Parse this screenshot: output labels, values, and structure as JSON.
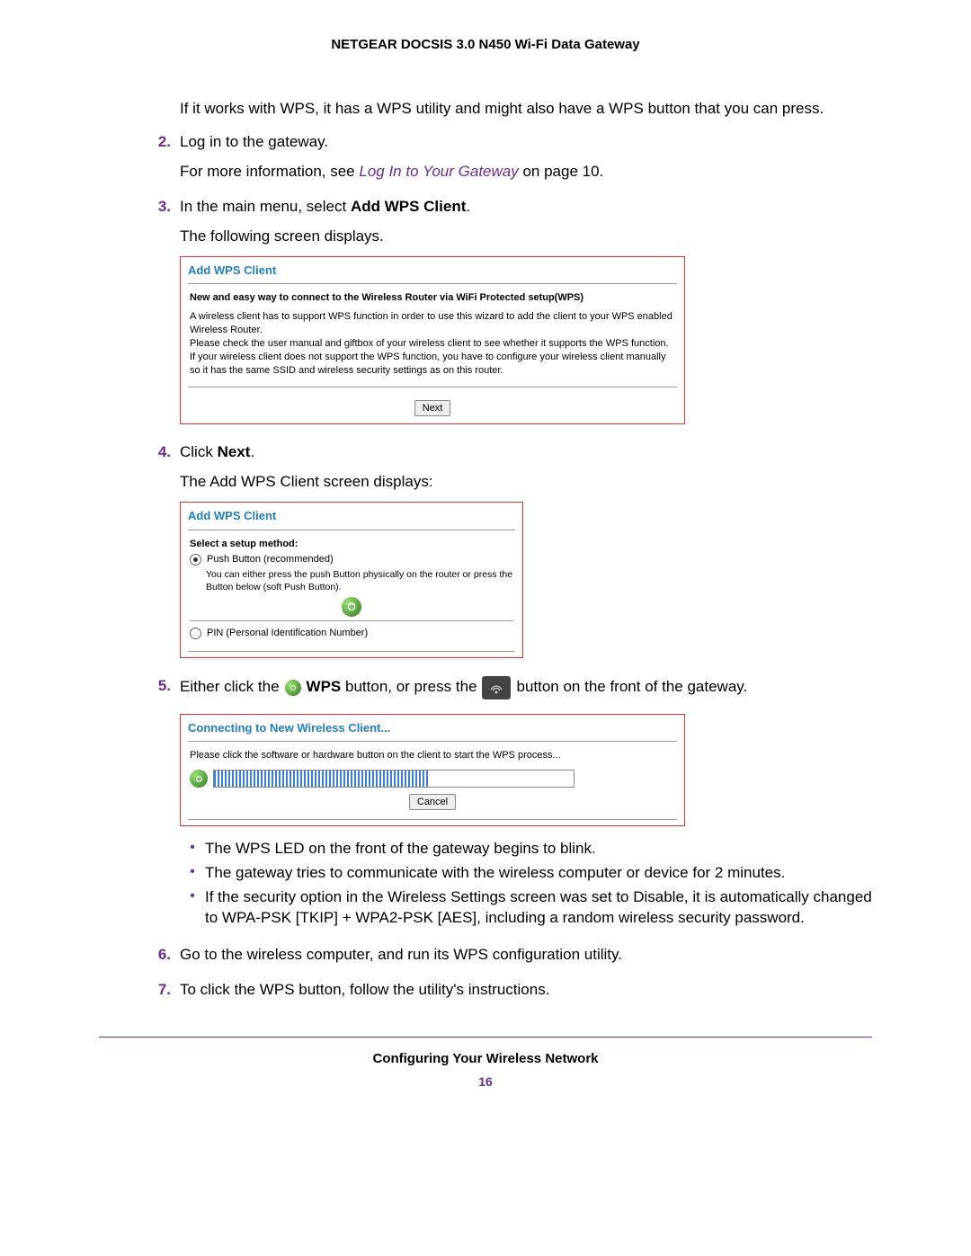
{
  "header": "NETGEAR DOCSIS 3.0 N450 Wi-Fi Data Gateway",
  "intro": "If it works with WPS, it has a WPS utility and might also have a WPS button that you can press.",
  "step2": {
    "num": "2.",
    "line1": "Log in to the gateway.",
    "line2_a": "For more information, see ",
    "line2_link": "Log In to Your Gateway",
    "line2_b": " on page 10."
  },
  "step3": {
    "num": "3.",
    "line1_a": "In the main menu, select ",
    "line1_b": "Add WPS Client",
    "line1_c": ".",
    "line2": "The following screen displays."
  },
  "shot1": {
    "title": "Add WPS Client",
    "bold": "New and easy way to connect to the Wireless Router via WiFi Protected setup(WPS)",
    "p1": "A wireless client has to support WPS function in order to use this wizard to add the client to your WPS enabled Wireless Router.",
    "p2": "Please check the user manual and giftbox of your wireless client to see whether it supports the WPS function.",
    "p3": "If your wireless client does not support the WPS function, you have to configure your wireless client manually so it has the same SSID and wireless security settings as on this router.",
    "next": "Next"
  },
  "step4": {
    "num": "4.",
    "line1_a": "Click ",
    "line1_b": "Next",
    "line1_c": ".",
    "line2": "The Add WPS Client screen displays:"
  },
  "shot2": {
    "title": "Add WPS Client",
    "select": "Select a setup method:",
    "opt1": "Push Button (recommended)",
    "opt1_desc": "You can either press the push Button physically on the router or press the Button below (soft Push Button).",
    "opt2": "PIN (Personal Identification Number)"
  },
  "step5": {
    "num": "5.",
    "a": "Either click the ",
    "wps": "WPS",
    "b": " button, or press the ",
    "c": " button on the front of the gateway."
  },
  "shot3": {
    "title": "Connecting to New Wireless Client...",
    "msg": "Please click the software or hardware button on the client to start the WPS process...",
    "cancel": "Cancel"
  },
  "bullets": {
    "b1": "The WPS LED on the front of the gateway begins to blink.",
    "b2": "The gateway tries to communicate with the wireless computer or device for 2 minutes.",
    "b3": "If the security option in the Wireless Settings screen was set to Disable, it is automatically changed to WPA-PSK [TKIP] + WPA2-PSK [AES], including a random wireless security password."
  },
  "step6": {
    "num": "6.",
    "text": "Go to the wireless computer, and run its WPS configuration utility."
  },
  "step7": {
    "num": "7.",
    "text": "To click the WPS button, follow the utility's instructions."
  },
  "footer": {
    "title": "Configuring Your Wireless Network",
    "page": "16"
  }
}
